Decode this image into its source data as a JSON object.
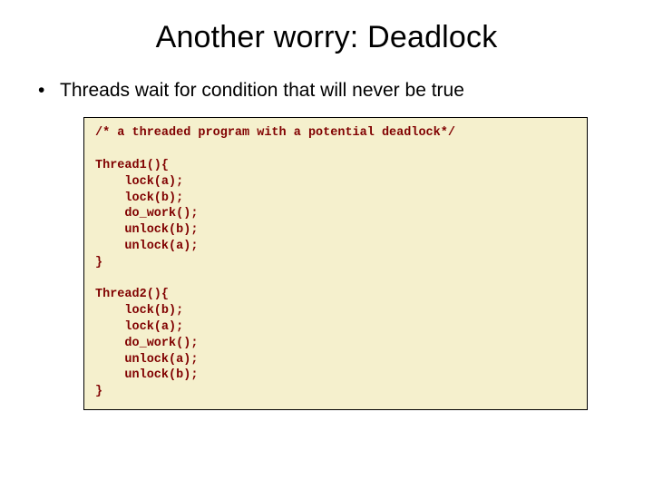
{
  "title": "Another worry: Deadlock",
  "bullet1": "Threads wait for condition that will never be true",
  "code": "/* a threaded program with a potential deadlock*/\n\nThread1(){\n    lock(a);\n    lock(b);\n    do_work();\n    unlock(b);\n    unlock(a);\n}\n\nThread2(){\n    lock(b);\n    lock(a);\n    do_work();\n    unlock(a);\n    unlock(b);\n}"
}
